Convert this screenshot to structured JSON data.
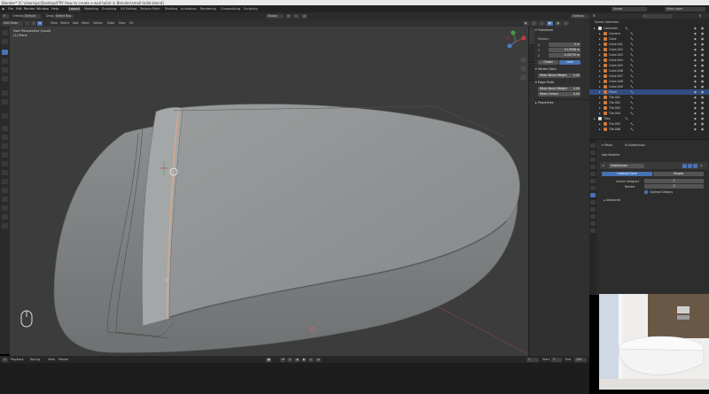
{
  "titlebar": {
    "text": "Blender* [C:\\Users\\pc\\Desktop\\FPV How to create a wall toilet in Blender\\small toilet.blend]"
  },
  "menubar": {
    "items": [
      "File",
      "Edit",
      "Render",
      "Window",
      "Help"
    ],
    "workspaces": [
      "Layout",
      "Modeling",
      "Sculpting",
      "UV Editing",
      "Texture Paint",
      "Shading",
      "Animation",
      "Rendering",
      "Compositing",
      "Scripting"
    ],
    "active_workspace": "Layout",
    "scene_label": "Scene",
    "view_layer_label": "View Layer"
  },
  "header2": {
    "mode_icon": "cursor-icon",
    "orientation_label": "Orientation:",
    "orientation_value": "Default",
    "drag_label": "Drag:",
    "drag_value": "Select Box",
    "transform_label": "Global",
    "options_label": "Options"
  },
  "header3": {
    "mode_value": "Edit Mode",
    "menus": [
      "View",
      "Select",
      "Add",
      "Mesh",
      "Vertex",
      "Edge",
      "Face",
      "UV"
    ]
  },
  "viewport": {
    "view_label": "User Perspective (Local)",
    "object_label": "(1) Plane"
  },
  "npanel": {
    "transform_header": "Transform",
    "median_label": "Median:",
    "rows": [
      {
        "label": "X",
        "value": "0 m"
      },
      {
        "label": "Y",
        "value": "0.10998 m"
      },
      {
        "label": "Z",
        "value": "-0.00733 m"
      }
    ],
    "global_btn": "Global",
    "local_btn": "Local",
    "vertex_data_header": "Vertex Data",
    "mean_bevel_weight": "Mean Bevel Weight",
    "mean_bevel_value": "0.00",
    "edge_data_header": "Edge Data",
    "edge_bevel_weight": "Mean Bevel Weight",
    "edge_bevel_value": "0.00",
    "mean_crease": "Mean Crease",
    "mean_crease_value": "0.00",
    "properties_header": "Properties"
  },
  "outliner": {
    "header": "Scene Collection",
    "rows": [
      {
        "name": "Collection",
        "icon_color": "#e0e0e0",
        "indent": 1,
        "selected": false
      },
      {
        "name": "Camera",
        "icon_color": "#d27a3a",
        "indent": 2,
        "selected": false
      },
      {
        "name": "Cube",
        "icon_color": "#d27a3a",
        "indent": 2,
        "selected": false
      },
      {
        "name": "Cube.001",
        "icon_color": "#d27a3a",
        "indent": 2,
        "selected": false
      },
      {
        "name": "Cube.002",
        "icon_color": "#d27a3a",
        "indent": 2,
        "selected": false
      },
      {
        "name": "Cube.003",
        "icon_color": "#d27a3a",
        "indent": 2,
        "selected": false
      },
      {
        "name": "Cube.004",
        "icon_color": "#d27a3a",
        "indent": 2,
        "selected": false
      },
      {
        "name": "Cube.005",
        "icon_color": "#d27a3a",
        "indent": 2,
        "selected": false
      },
      {
        "name": "Cube.006",
        "icon_color": "#d27a3a",
        "indent": 2,
        "selected": false
      },
      {
        "name": "Cube.007",
        "icon_color": "#d27a3a",
        "indent": 2,
        "selected": false
      },
      {
        "name": "Cube.008",
        "icon_color": "#d27a3a",
        "indent": 2,
        "selected": false
      },
      {
        "name": "Cube.009",
        "icon_color": "#d27a3a",
        "indent": 2,
        "selected": false
      },
      {
        "name": "Plane",
        "icon_color": "#d27a3a",
        "indent": 2,
        "selected": true
      },
      {
        "name": "Tile.001",
        "icon_color": "#d27a3a",
        "indent": 2,
        "selected": false
      },
      {
        "name": "Tile.002",
        "icon_color": "#d27a3a",
        "indent": 2,
        "selected": false
      },
      {
        "name": "Tile.003",
        "icon_color": "#d27a3a",
        "indent": 2,
        "selected": false
      },
      {
        "name": "Tile.004",
        "icon_color": "#d27a3a",
        "indent": 2,
        "selected": false
      },
      {
        "name": "Tiles",
        "icon_color": "#e0e0e0",
        "indent": 1,
        "selected": false
      },
      {
        "name": "Tile.005",
        "icon_color": "#d27a3a",
        "indent": 2,
        "selected": false
      },
      {
        "name": "Tile.006",
        "icon_color": "#d27a3a",
        "indent": 2,
        "selected": false
      }
    ]
  },
  "properties": {
    "object_name": "Plane",
    "modifier_tab": "Subdivision",
    "add_modifier": "Add Modifier",
    "modifier_name": "Subdivision",
    "catmull_clark": "Catmull-Clark",
    "simple": "Simple",
    "levels_viewport_label": "Levels Viewport",
    "levels_viewport_value": "1",
    "render_label": "Render",
    "render_value": "2",
    "optimal_display": "Optimal Display",
    "advanced": "Advanced"
  },
  "statusbar": {
    "playback": "Playback",
    "keying": "Keying",
    "view": "View",
    "marker": "Marker",
    "start_label": "Start",
    "start_value": "1",
    "end_label": "End",
    "end_value": "250",
    "current_frame": "1"
  },
  "colors": {
    "accent": "#4772b3",
    "selection": "#334d80",
    "viewport_bg": "#3c3c3c",
    "mesh_fill": "#8c8f90"
  }
}
